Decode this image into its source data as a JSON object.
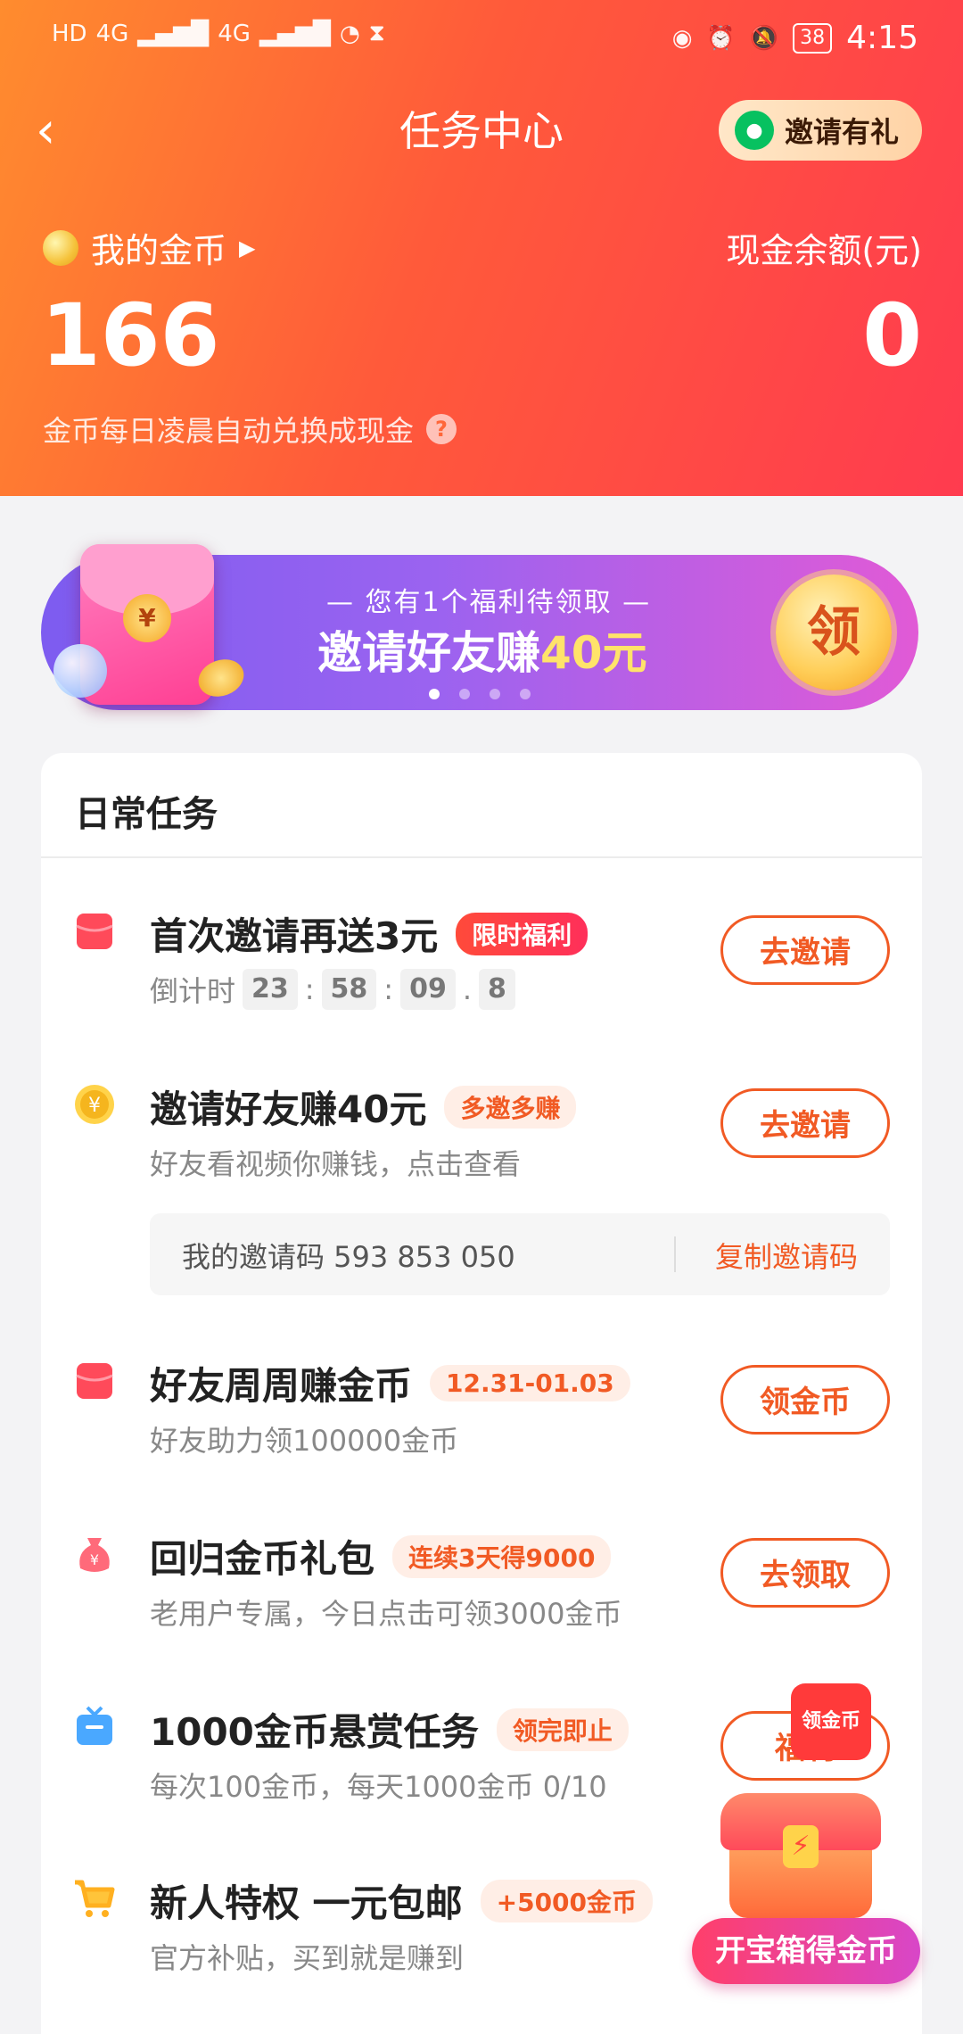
{
  "status_bar": {
    "hd1": "HD",
    "hd2": "HD",
    "net1": "4G",
    "net2": "4G",
    "battery": "38",
    "time": "4:15"
  },
  "header": {
    "back_glyph": "‹",
    "title": "任务中心",
    "invite_label": "邀请有礼",
    "coins_label": "我的金币",
    "cash_label": "现金余额(元)",
    "coins_value": "166",
    "cash_value": "0",
    "hint": "金币每日凌晨自动兑换成现金",
    "hint_icon": "?"
  },
  "banner": {
    "subtitle": "— 您有1个福利待领取 —",
    "main_prefix": "邀请好友赚",
    "main_amount": "40元",
    "claim_label": "领",
    "envelope_seal": "¥",
    "dots_count": 4,
    "active_dot": 0
  },
  "daily": {
    "title": "日常任务",
    "tasks": [
      {
        "title": "首次邀请再送3元",
        "tag": "限时福利",
        "timer_label": "倒计时",
        "timer": [
          "23",
          "58",
          "09",
          "8"
        ],
        "button": "去邀请"
      },
      {
        "title": "邀请好友赚40元",
        "tag": "多邀多赚",
        "desc": "好友看视频你赚钱，点击查看",
        "code_label": "我的邀请码 593 853 050",
        "copy_label": "复制邀请码",
        "button": "去邀请"
      },
      {
        "title": "好友周周赚金币",
        "tag": "12.31-01.03",
        "desc": "好友助力领100000金币",
        "button": "领金币"
      },
      {
        "title": "回归金币礼包",
        "tag": "连续3天得9000",
        "desc": "老用户专属，今日点击可领3000金币",
        "button": "去领取"
      },
      {
        "title": "1000金币悬赏任务",
        "tag": "领完即止",
        "desc": "每次100金币，每天1000金币 0/10",
        "button": "福利",
        "badge": "领金币"
      },
      {
        "title": "新人特权 一元包邮",
        "tag": "+5000金币",
        "desc": "官方补贴，买到就是赚到"
      }
    ]
  },
  "chest": {
    "button": "开宝箱得金币"
  },
  "colors": {
    "header_start": "#ff8c2e",
    "header_end": "#ff3b4f",
    "accent": "#f15a24",
    "banner_start": "#7d5cf0",
    "banner_end": "#e15ad6"
  }
}
